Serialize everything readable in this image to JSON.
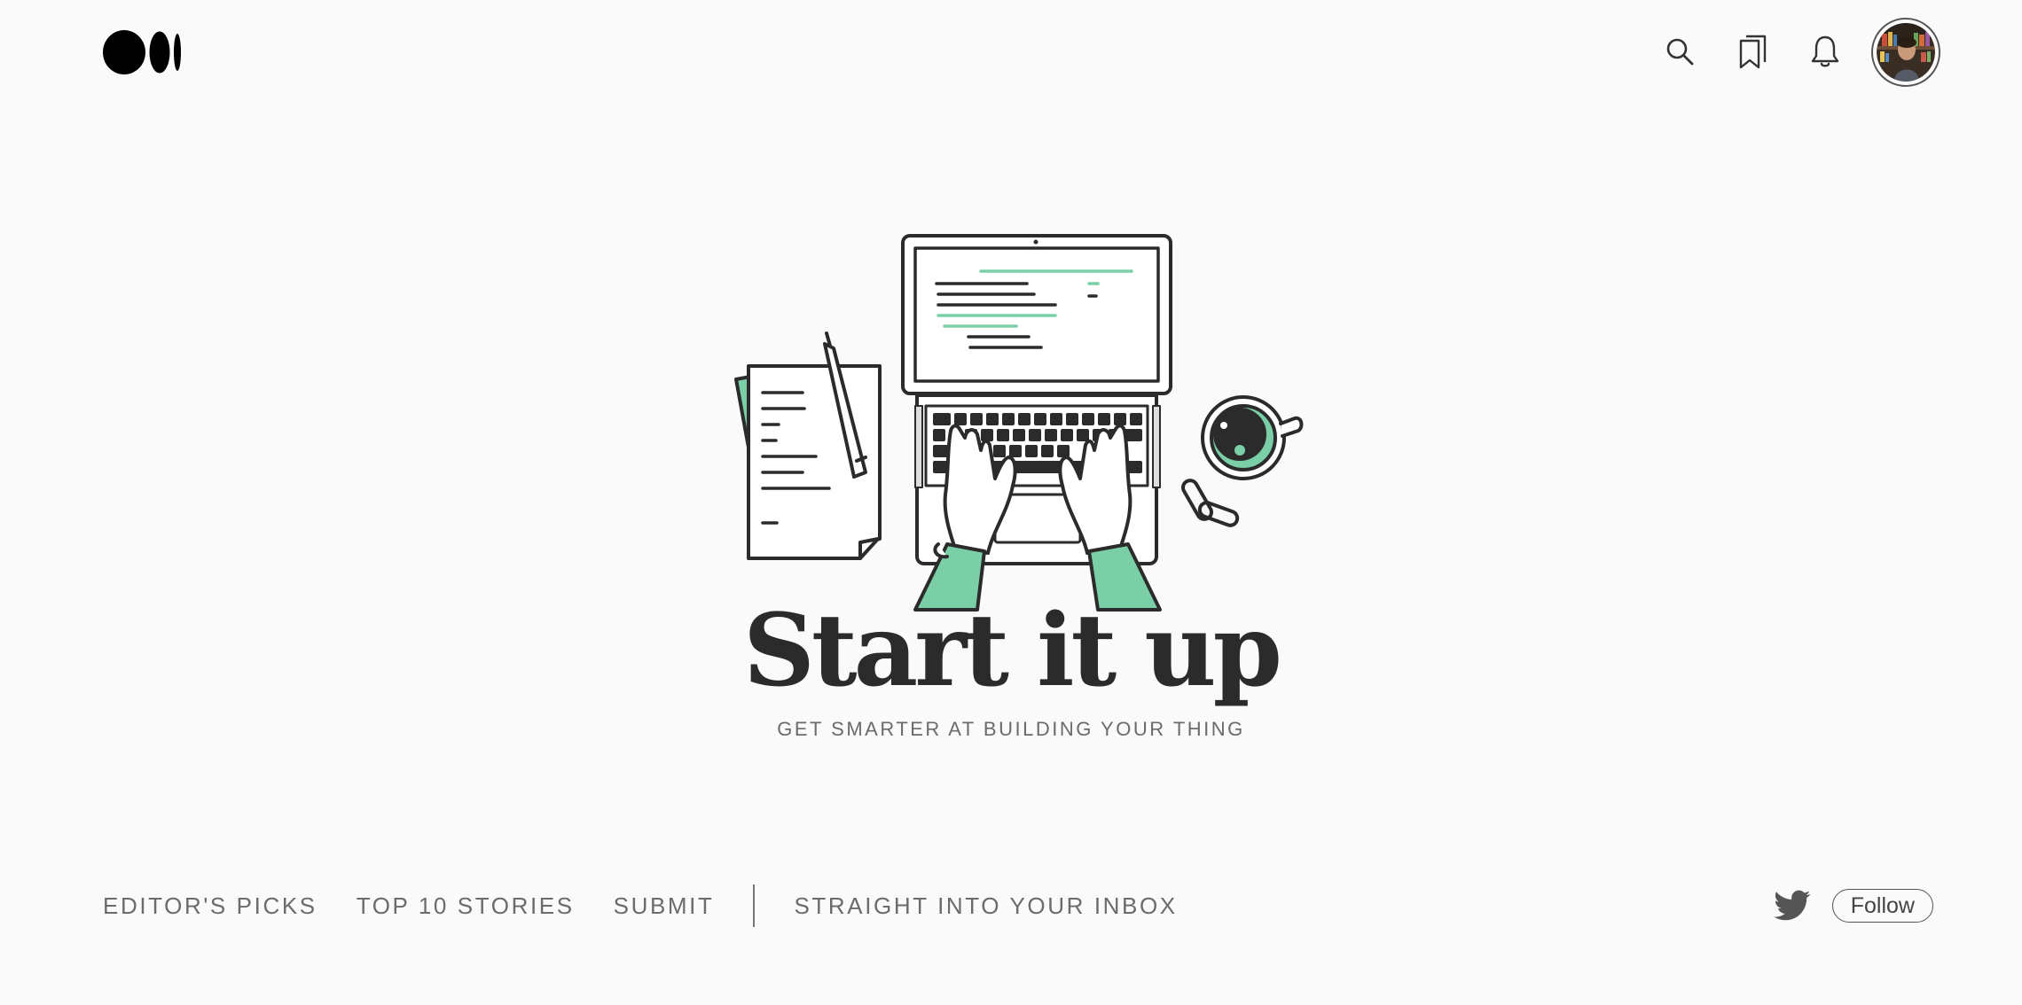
{
  "header": {
    "logo_name": "medium-logo",
    "icons": [
      "search-icon",
      "bookmarks-icon",
      "bell-icon"
    ],
    "avatar_name": "user-avatar"
  },
  "hero": {
    "title": "Start it up",
    "subtitle": "GET SMARTER AT BUILDING YOUR THING"
  },
  "nav": {
    "items": [
      {
        "label": "EDITOR'S PICKS"
      },
      {
        "label": "TOP 10 STORIES"
      },
      {
        "label": "SUBMIT"
      },
      {
        "label": "STRAIGHT INTO YOUR INBOX"
      }
    ]
  },
  "social": {
    "twitter_icon": "twitter-icon",
    "follow_label": "Follow"
  },
  "colors": {
    "background": "#fafafa",
    "text_dark": "#2b2b2b",
    "text_muted": "#6b6b6b",
    "accent_green": "#7bcfa6"
  }
}
